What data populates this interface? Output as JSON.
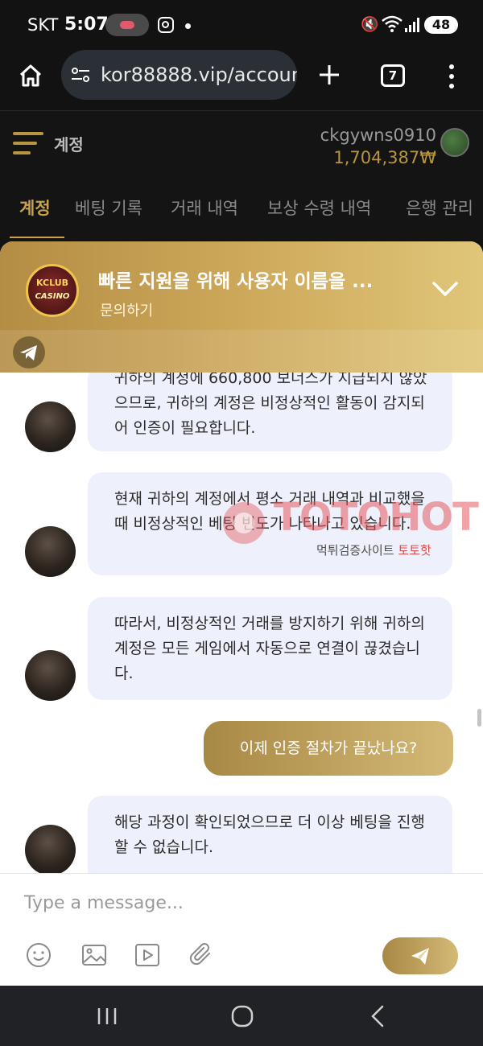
{
  "status_bar": {
    "carrier": "SKT",
    "time": "5:07",
    "battery": "48"
  },
  "browser": {
    "url": "kor88888.vip/accoun",
    "tab_count": "7"
  },
  "site_header": {
    "title": "계정",
    "username": "ckgywns0910",
    "balance": "1,704,387₩"
  },
  "tabs": [
    {
      "label": "계정",
      "active": true
    },
    {
      "label": "베팅 기록",
      "active": false
    },
    {
      "label": "거래 내역",
      "active": false
    },
    {
      "label": "보상 수령 내역",
      "active": false
    },
    {
      "label": "은행 관리",
      "active": false
    }
  ],
  "chat": {
    "header_title": "빠른 지원을 위해 사용자 이름을 ...",
    "header_subtitle": "문의하기",
    "logo_line1": "KCLUB",
    "logo_line2": "CASINO",
    "messages": [
      {
        "type": "in",
        "text": "귀하의 계정에 660,800 보너스가 지급되지 않았으므로, 귀하의 계정은 비정상적인 활동이 감지되어 인증이 필요합니다."
      },
      {
        "type": "in",
        "text": "현재 귀하의 계정에서 평소 거래 내역과 비교했을 때 비정상적인 베팅 빈도가 나타나고 있습니다."
      },
      {
        "type": "in",
        "text": "따라서, 비정상적인 거래를 방지하기 위해 귀하의 계정은 모든 게임에서 자동으로 연결이 끊겼습니다."
      },
      {
        "type": "out",
        "text": "이제 인증 절차가 끝났나요?"
      },
      {
        "type": "in",
        "text": "해당 과정이 확인되었으므로 더 이상 베팅을 진행할 수 없습니다."
      }
    ],
    "input_placeholder": "Type a message..."
  },
  "watermark": {
    "brand": "TOTOHOT",
    "caption_prefix": "먹튀검증사이트",
    "caption_accent": "토토핫"
  },
  "colors": {
    "gold_accent": "#c9a14a",
    "header_gradient_start": "#b48d44",
    "header_gradient_end": "#e0c679",
    "bubble_in_bg": "#eef1fb"
  },
  "icons": {
    "home": "home-icon",
    "site_settings": "tune-icon",
    "new_tab": "plus-icon",
    "tabs": "tabs-icon",
    "more": "more-vert-icon",
    "menu": "menu-icon",
    "collapse": "chevron-down-icon",
    "telegram": "telegram-icon",
    "emoji": "emoji-icon",
    "image": "image-icon",
    "video": "video-icon",
    "attach": "paperclip-icon",
    "send": "send-icon"
  }
}
